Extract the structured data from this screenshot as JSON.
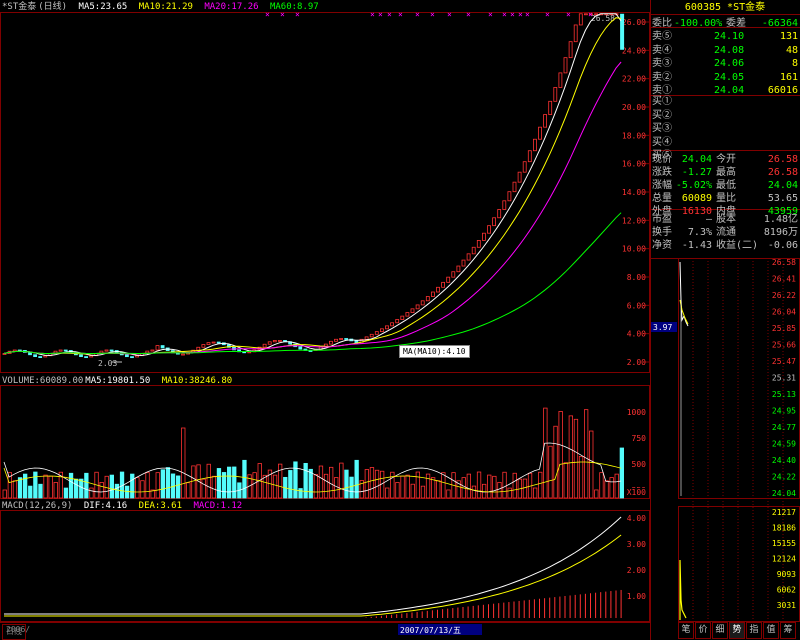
{
  "header": {
    "stock_name": "*ST金泰",
    "period": "(日线)",
    "ma5": "MA5:23.65",
    "ma10": "MA10:21.29",
    "ma20": "MA20:17.26",
    "ma60": "MA60:8.97"
  },
  "price_axis": {
    "labels": [
      "26.00",
      "24.00",
      "22.00",
      "20.00",
      "18.00",
      "16.00",
      "14.00",
      "12.00",
      "10.00",
      "8.00",
      "6.00",
      "4.00",
      "2.00"
    ],
    "high_label": "26.58",
    "low_label": "2.03",
    "cursor_price": "3.97"
  },
  "ma10_tooltip": "MA(MA10):4.10",
  "volume": {
    "label": "VOLUME:60089.00",
    "ma5": "MA5:19801.50",
    "ma10": "MA10:38246.80",
    "axis": [
      "1000",
      "750",
      "500",
      "250"
    ],
    "unit": "X100"
  },
  "macd": {
    "label": "MACD(12,26,9)",
    "dif": "DIF:4.16",
    "dea": "DEA:3.61",
    "macd": "MACD:1.12",
    "axis": [
      "4.00",
      "3.00",
      "2.00",
      "1.00"
    ]
  },
  "date_axis": {
    "highlight": "2007/07/13/五",
    "first": "2006/"
  },
  "quote": {
    "code": "600385",
    "name": "*ST金泰",
    "weibi_label": "委比",
    "weibi_value": "-100.00%",
    "weicha_label": "委差",
    "weicha_value": "-66364",
    "sells": [
      {
        "label": "卖⑤",
        "price": "24.10",
        "vol": "131"
      },
      {
        "label": "卖④",
        "price": "24.08",
        "vol": "48"
      },
      {
        "label": "卖③",
        "price": "24.06",
        "vol": "8"
      },
      {
        "label": "卖②",
        "price": "24.05",
        "vol": "161"
      },
      {
        "label": "卖①",
        "price": "24.04",
        "vol": "66016"
      }
    ],
    "buys": [
      "买①",
      "买②",
      "买③",
      "买④",
      "买⑤"
    ],
    "stats": [
      {
        "l1": "现价",
        "v1": "24.04",
        "l2": "今开",
        "v2": "26.58"
      },
      {
        "l1": "涨跌",
        "v1": "-1.27",
        "l2": "最高",
        "v2": "26.58"
      },
      {
        "l1": "涨幅",
        "v1": "-5.02%",
        "l2": "最低",
        "v2": "24.04"
      },
      {
        "l1": "总量",
        "v1": "60089",
        "l2": "量比",
        "v2": "53.65"
      },
      {
        "l1": "外盘",
        "v1": "16130",
        "l2": "内盘",
        "v2": "43959"
      }
    ],
    "stats2": [
      {
        "l1": "市盈",
        "v1": "—",
        "l2": "股本",
        "v2": "1.48亿"
      },
      {
        "l1": "换手",
        "v1": "7.3%",
        "l2": "流通",
        "v2": "8196万"
      },
      {
        "l1": "净资",
        "v1": "-1.43",
        "l2": "收益(二)",
        "v2": "-0.06"
      }
    ]
  },
  "intraday": {
    "price_labels": [
      "26.58",
      "26.41",
      "26.22",
      "26.04",
      "25.85",
      "25.66",
      "25.47",
      "25.31",
      "25.13",
      "24.95",
      "24.77",
      "24.59",
      "24.40",
      "24.22",
      "24.04"
    ],
    "vol_labels": [
      "21217",
      "18186",
      "15155",
      "12124",
      "9093",
      "6062",
      "3031"
    ]
  },
  "tabs": [
    "笔",
    "价",
    "细",
    "势",
    "指",
    "值",
    "筹"
  ],
  "bottom_tab": "日线",
  "colors": {
    "up": "#ff3232",
    "down": "#54fcfc",
    "ma5": "#ffffff",
    "ma10": "#ffff00",
    "ma20": "#ff00ff",
    "ma60": "#00ff00",
    "grid": "#800000"
  }
}
